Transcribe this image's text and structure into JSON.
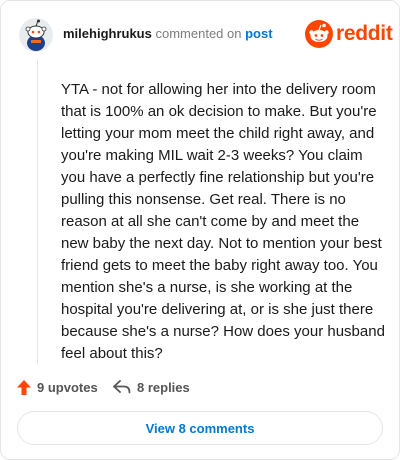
{
  "header": {
    "username": "milehighrukus",
    "verb": "commented on",
    "target_link": "post",
    "brand": "reddit"
  },
  "comment": {
    "text": "YTA - not for allowing her into the delivery room that is 100% an ok decision to make. But you're letting your mom meet the child right away, and you're making MIL wait 2-3 weeks? You claim you have a perfectly fine relationship but you're pulling this nonsense. Get real. There is no reason at all she can't come by and meet the new baby the next day. Not to mention your best friend gets to meet the baby right away too. You mention she's a nurse, is she working at the hospital you're delivering at, or is she just there because she's a nurse? How does your husband feel about this?"
  },
  "actions": {
    "upvotes": "9 upvotes",
    "replies": "8 replies"
  },
  "footer": {
    "view_comments": "View 8 comments"
  },
  "colors": {
    "brand": "#ff4500",
    "link": "#0079d3",
    "upvote": "#ff4500"
  },
  "icons": {
    "avatar": "snoo-avatar",
    "brand": "reddit-logo-icon",
    "upvote": "upvote-arrow-icon",
    "reply": "reply-arrow-icon"
  }
}
